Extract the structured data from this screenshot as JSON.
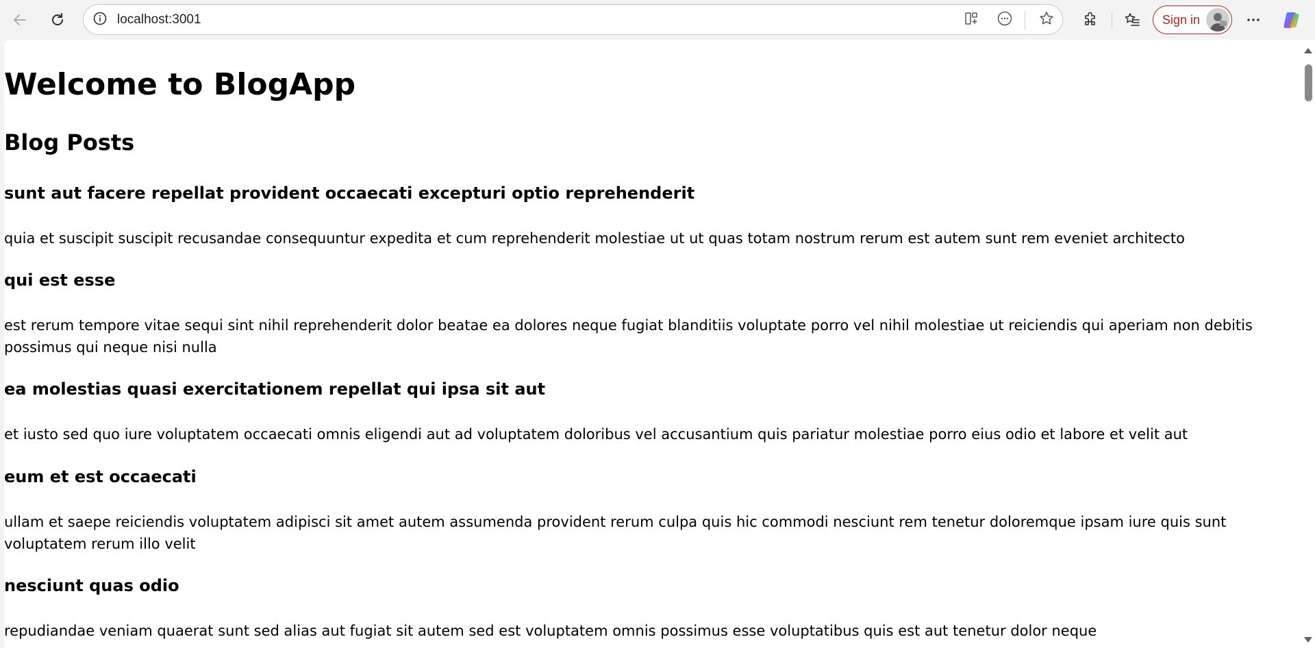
{
  "browser": {
    "url": "localhost:3001",
    "signin_label": "Sign in",
    "accent_color": "#b3261e",
    "icons": [
      "back-icon",
      "refresh-icon",
      "site-info-icon",
      "split-screen-icon",
      "more-tools-icon",
      "favorite-star-icon",
      "extensions-icon",
      "favorites-icon",
      "profile-avatar",
      "settings-more-icon",
      "copilot-icon"
    ]
  },
  "page": {
    "title": "Welcome to BlogApp",
    "section_title": "Blog Posts",
    "posts": [
      {
        "title": "sunt aut facere repellat provident occaecati excepturi optio reprehenderit",
        "body": "quia et suscipit suscipit recusandae consequuntur expedita et cum reprehenderit molestiae ut ut quas totam nostrum rerum est autem sunt rem eveniet architecto"
      },
      {
        "title": "qui est esse",
        "body": "est rerum tempore vitae sequi sint nihil reprehenderit dolor beatae ea dolores neque fugiat blanditiis voluptate porro vel nihil molestiae ut reiciendis qui aperiam non debitis possimus qui neque nisi nulla"
      },
      {
        "title": "ea molestias quasi exercitationem repellat qui ipsa sit aut",
        "body": "et iusto sed quo iure voluptatem occaecati omnis eligendi aut ad voluptatem doloribus vel accusantium quis pariatur molestiae porro eius odio et labore et velit aut"
      },
      {
        "title": "eum et est occaecati",
        "body": "ullam et saepe reiciendis voluptatem adipisci sit amet autem assumenda provident rerum culpa quis hic commodi nesciunt rem tenetur doloremque ipsam iure quis sunt voluptatem rerum illo velit"
      },
      {
        "title": "nesciunt quas odio",
        "body": "repudiandae veniam quaerat sunt sed alias aut fugiat sit autem sed est voluptatem omnis possimus esse voluptatibus quis est aut tenetur dolor neque"
      }
    ]
  }
}
